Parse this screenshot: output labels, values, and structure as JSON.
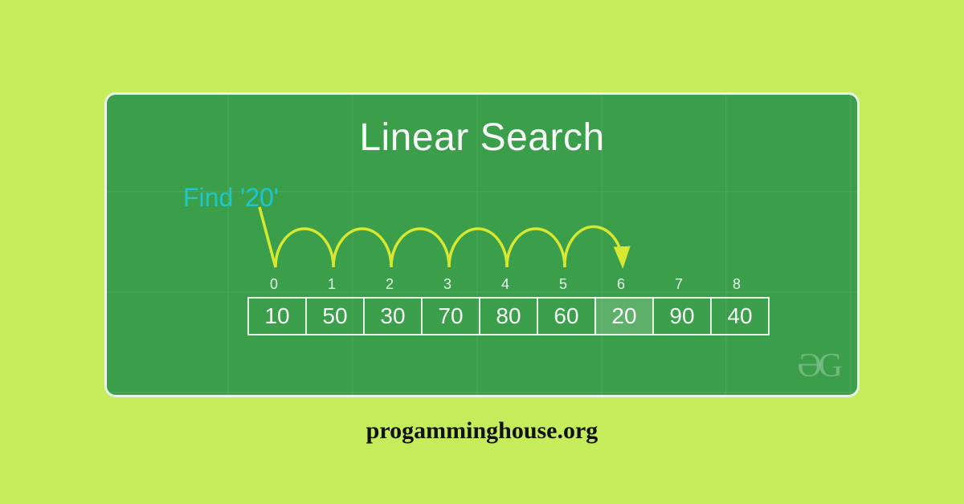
{
  "title": "Linear Search",
  "find_label": "Find '20'",
  "indices": [
    "0",
    "1",
    "2",
    "3",
    "4",
    "5",
    "6",
    "7",
    "8"
  ],
  "values": [
    "10",
    "50",
    "30",
    "70",
    "80",
    "60",
    "20",
    "90",
    "40"
  ],
  "highlight_index": 6,
  "hop_count": 6,
  "logo": "ƏG",
  "caption": "progamminghouse.org",
  "colors": {
    "bg": "#c5ec5a",
    "card": "#3b9e4a",
    "border": "#e8f5ea",
    "accent": "#1ec7cf",
    "arc": "#d6e830"
  }
}
